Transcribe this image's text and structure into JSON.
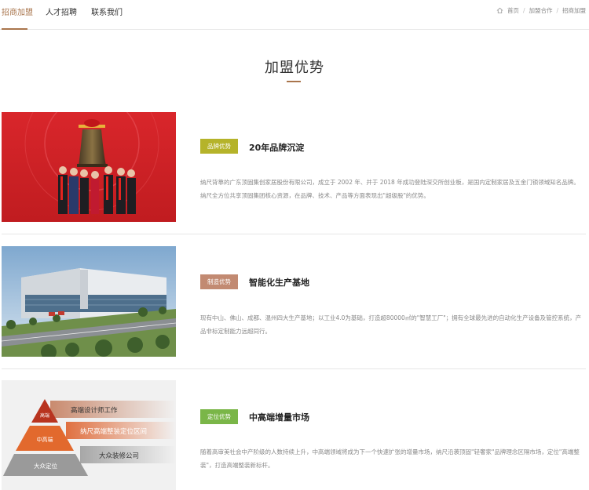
{
  "nav": {
    "tabs": [
      {
        "label": "招商加盟",
        "active": true
      },
      {
        "label": "人才招聘",
        "active": false
      },
      {
        "label": "联系我们",
        "active": false
      }
    ],
    "breadcrumb": [
      "首页",
      "加盟合作",
      "招商加盟"
    ]
  },
  "page": {
    "title": "加盟优势"
  },
  "sections": [
    {
      "badge": "品牌优势",
      "badge_color": "#b5b32a",
      "title": "20年品牌沉淀",
      "desc": "纳尺背靠的广东顶固集创家居股份有限公司，成立于 2002 年、并于 2018 年成功登陆深交所创业板，是国内定制家居及五金门锁领域知名品牌。纳尺全方位共享顶固集团核心资源，在品牌、技术、产品等方面表现出\"超级股\"的优势。"
    },
    {
      "badge": "制造优势",
      "badge_color": "#c28a72",
      "title": "智能化生产基地",
      "desc": "现有中山、佛山、成都、温州四大生产基地；以工业4.0为基础，打造超80000㎡的\"智慧工厂\"；拥有全球最先进的自动化生产设备及管控系统，产品非标定制能力远超同行。"
    },
    {
      "badge": "定位优势",
      "badge_color": "#7ab648",
      "title": "中高端增量市场",
      "desc": "随着高审美社会中产阶级的人数持续上升，中高端领域将成为下一个快速扩张的增量市场，纳尺沿袭顶固\"轻奢家\"品牌理念区隔市场，定位\"高端整装\"，打造高端整装新标杆。"
    }
  ],
  "pyramid": {
    "labels": [
      "高端",
      "中高端",
      "大众定位"
    ],
    "bands": [
      "高端设计师工作",
      "纳尺高端整装定位区间",
      "大众装修公司"
    ]
  }
}
